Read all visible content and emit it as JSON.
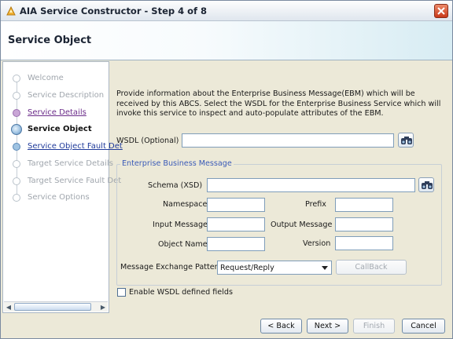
{
  "window": {
    "title": "AIA Service Constructor - Step 4 of 8"
  },
  "header": {
    "title": "Service Object"
  },
  "nav": {
    "items": [
      {
        "label": "Welcome",
        "state": "disabled"
      },
      {
        "label": "Service Description",
        "state": "disabled"
      },
      {
        "label": "Service Details",
        "state": "visited"
      },
      {
        "label": "Service Object",
        "state": "current"
      },
      {
        "label": "Service Object Fault Det",
        "state": "link"
      },
      {
        "label": "Target Service Details",
        "state": "disabled"
      },
      {
        "label": "Target Service Fault Det",
        "state": "disabled"
      },
      {
        "label": "Service Options",
        "state": "disabled"
      }
    ]
  },
  "content": {
    "description": "Provide information about the Enterprise Business Message(EBM) which will be received by this ABCS. Select the WSDL for the Enterprise Business Service which will invoke this service to inspect and auto-populate attributes of the EBM.",
    "wsdl_label": "WSDL (Optional)",
    "wsdl_value": "",
    "group_title": "Enterprise Business Message",
    "schema_label": "Schema (XSD)",
    "schema_value": "",
    "namespace_label": "Namespace",
    "namespace_value": "",
    "prefix_label": "Prefix",
    "prefix_value": "",
    "input_message_label": "Input Message",
    "input_message_value": "",
    "output_message_label": "Output Message",
    "output_message_value": "",
    "object_name_label": "Object Name",
    "object_name_value": "",
    "version_label": "Version",
    "version_value": "",
    "mep_label": "Message Exchange Pattern",
    "mep_value": "Request/Reply",
    "callback_label": "CallBack",
    "enable_wsdl_label": "Enable WSDL defined fields",
    "enable_wsdl_checked": false
  },
  "buttons": {
    "back": "< Back",
    "next": "Next >",
    "finish": "Finish",
    "cancel": "Cancel"
  },
  "icons": {
    "wsdl_browse": "binoculars-icon",
    "schema_browse": "binoculars-icon",
    "close": "close-icon",
    "app": "app-icon"
  }
}
